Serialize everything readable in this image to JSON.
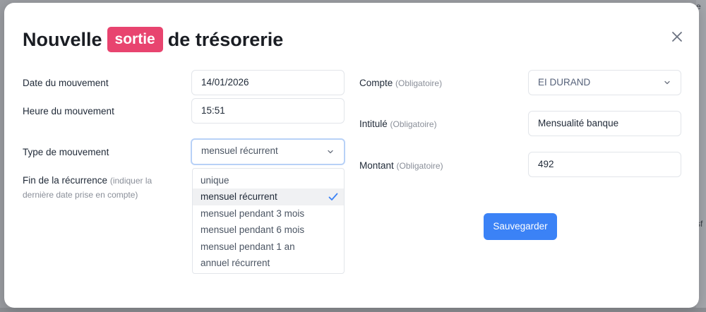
{
  "title": {
    "prefix": "Nouvelle",
    "badge": "sortie",
    "suffix": "de trésorerie"
  },
  "colors": {
    "badge": "#e8446f",
    "primary": "#3b82f6",
    "focus_ring": "#b8d1f7"
  },
  "form_left": {
    "date_label": "Date du mouvement",
    "date_value": "14/01/2026",
    "time_label": "Heure du mouvement",
    "time_value": "15:51",
    "type_label": "Type de mouvement",
    "type_value": "mensuel récurrent",
    "end_label": "Fin de la récurrence",
    "end_hint": "(indiquer la dernière date prise en compte)"
  },
  "type_options": [
    {
      "label": "unique",
      "selected": false
    },
    {
      "label": "mensuel récurrent",
      "selected": true
    },
    {
      "label": "mensuel pendant 3 mois",
      "selected": false
    },
    {
      "label": "mensuel pendant 6 mois",
      "selected": false
    },
    {
      "label": "mensuel pendant 1 an",
      "selected": false
    },
    {
      "label": "annuel récurrent",
      "selected": false
    }
  ],
  "form_right": {
    "account_label": "Compte",
    "account_hint": "(Obligatoire)",
    "account_value": "EI DURAND",
    "title_label": "Intitulé",
    "title_hint": "(Obligatoire)",
    "title_value": "Mensualité banque",
    "amount_label": "Montant",
    "amount_hint": "(Obligatoire)",
    "amount_value": "492"
  },
  "actions": {
    "save_label": "Sauvegarder"
  },
  "background": {
    "fragments": [
      "e",
      "sf"
    ]
  },
  "icons": {
    "close": "close-icon",
    "chevron": "chevron-down-icon",
    "check": "check-icon"
  }
}
